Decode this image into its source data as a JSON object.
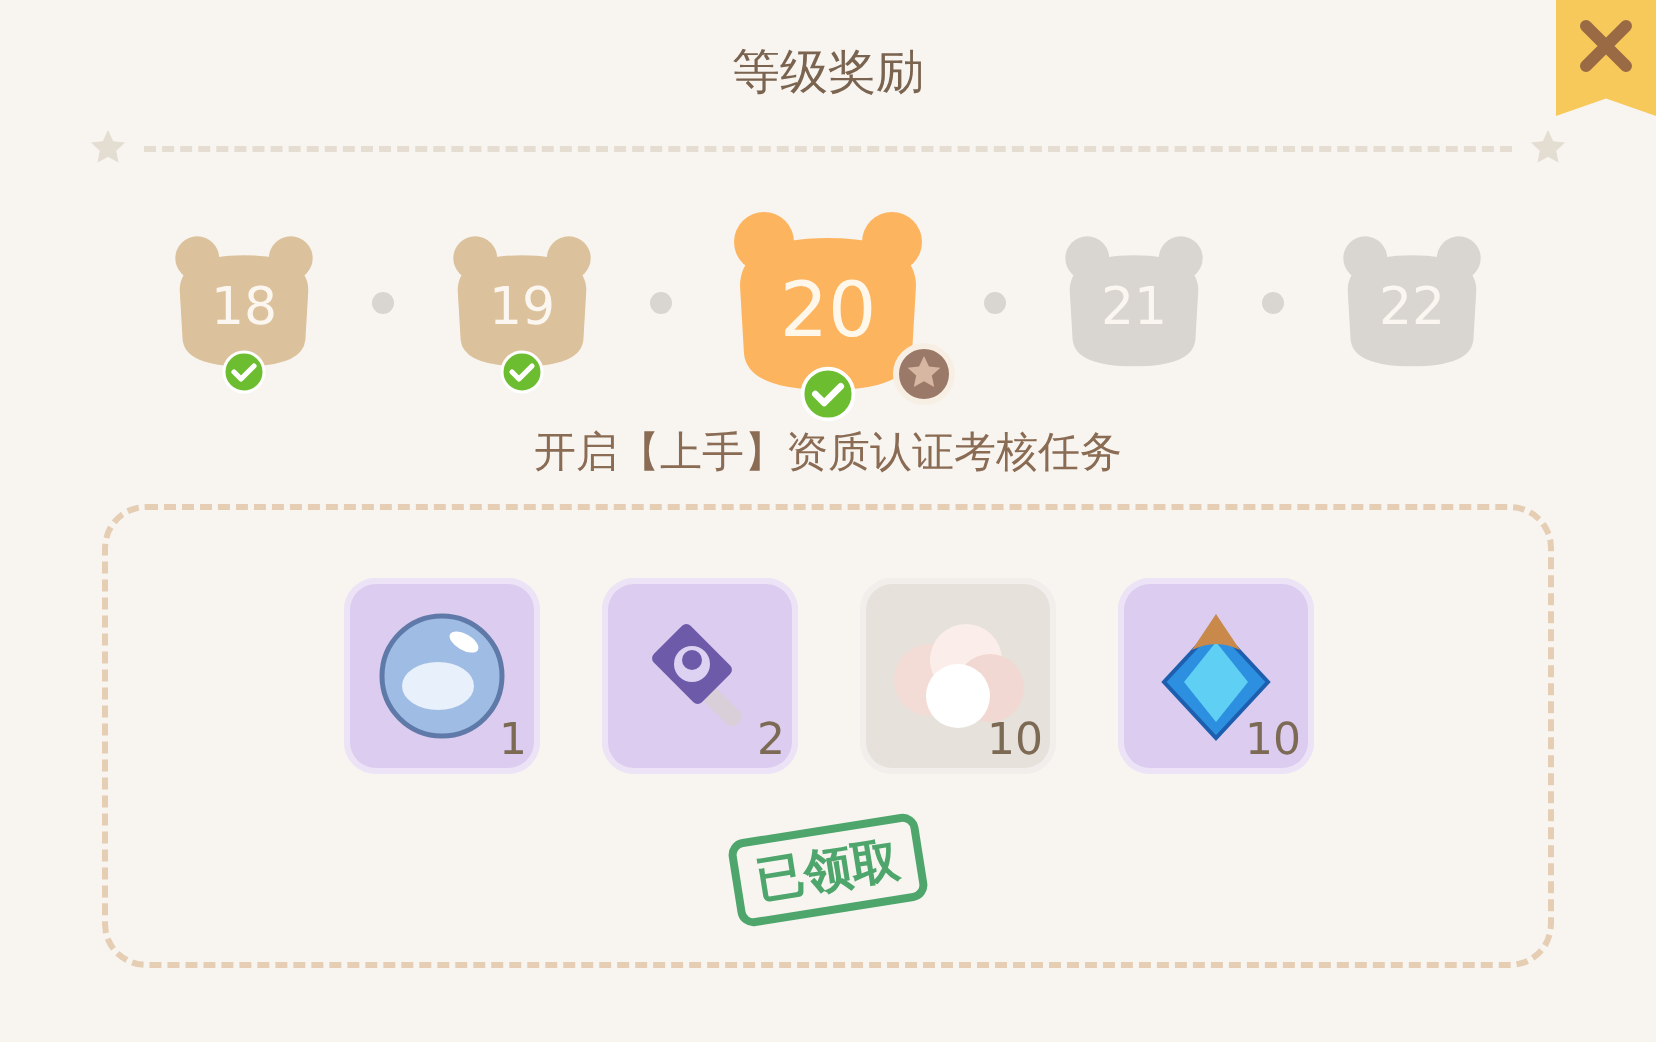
{
  "title": "等级奖励",
  "levels": [
    {
      "number": "18",
      "claimed": true,
      "selected": false,
      "locked": false
    },
    {
      "number": "19",
      "claimed": true,
      "selected": false,
      "locked": false
    },
    {
      "number": "20",
      "claimed": true,
      "selected": true,
      "locked": false
    },
    {
      "number": "21",
      "claimed": false,
      "selected": false,
      "locked": true
    },
    {
      "number": "22",
      "claimed": false,
      "selected": false,
      "locked": true
    }
  ],
  "unlock_text": "开启【上手】资质认证考核任务",
  "rewards": [
    {
      "kind": "orb",
      "count": "1",
      "color": "#dccdf0"
    },
    {
      "kind": "hammer",
      "count": "2",
      "color": "#dccdf0"
    },
    {
      "kind": "cotton",
      "count": "10",
      "color": "#e6e1db"
    },
    {
      "kind": "gem",
      "count": "10",
      "color": "#dccdf0"
    }
  ],
  "stamp": "已领取"
}
